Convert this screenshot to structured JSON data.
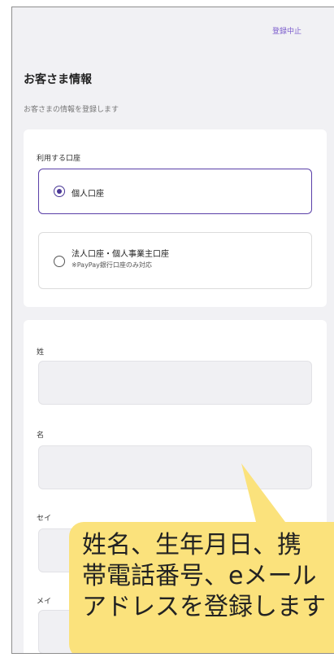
{
  "header": {
    "cancel_label": "登録中止"
  },
  "page": {
    "title": "お客さま情報",
    "subtitle": "お客さまの情報を登録します"
  },
  "account_section": {
    "label": "利用する口座",
    "options": [
      {
        "label": "個人口座",
        "selected": true
      },
      {
        "label": "法人口座・個人事業主口座",
        "note": "※PayPay銀行口座のみ対応",
        "selected": false
      }
    ]
  },
  "name_section": {
    "fields": [
      {
        "label": "姓",
        "value": ""
      },
      {
        "label": "名",
        "value": ""
      },
      {
        "label": "セイ",
        "value": ""
      },
      {
        "label": "メイ",
        "value": ""
      }
    ]
  },
  "callout": {
    "text": "姓名、生年月日、携\n帯電話番号、eメール\nアドレスを登録します"
  },
  "colors": {
    "accent": "#5a3fa8",
    "callout_bg": "#fbe27c",
    "page_bg": "#f1f1f4"
  }
}
